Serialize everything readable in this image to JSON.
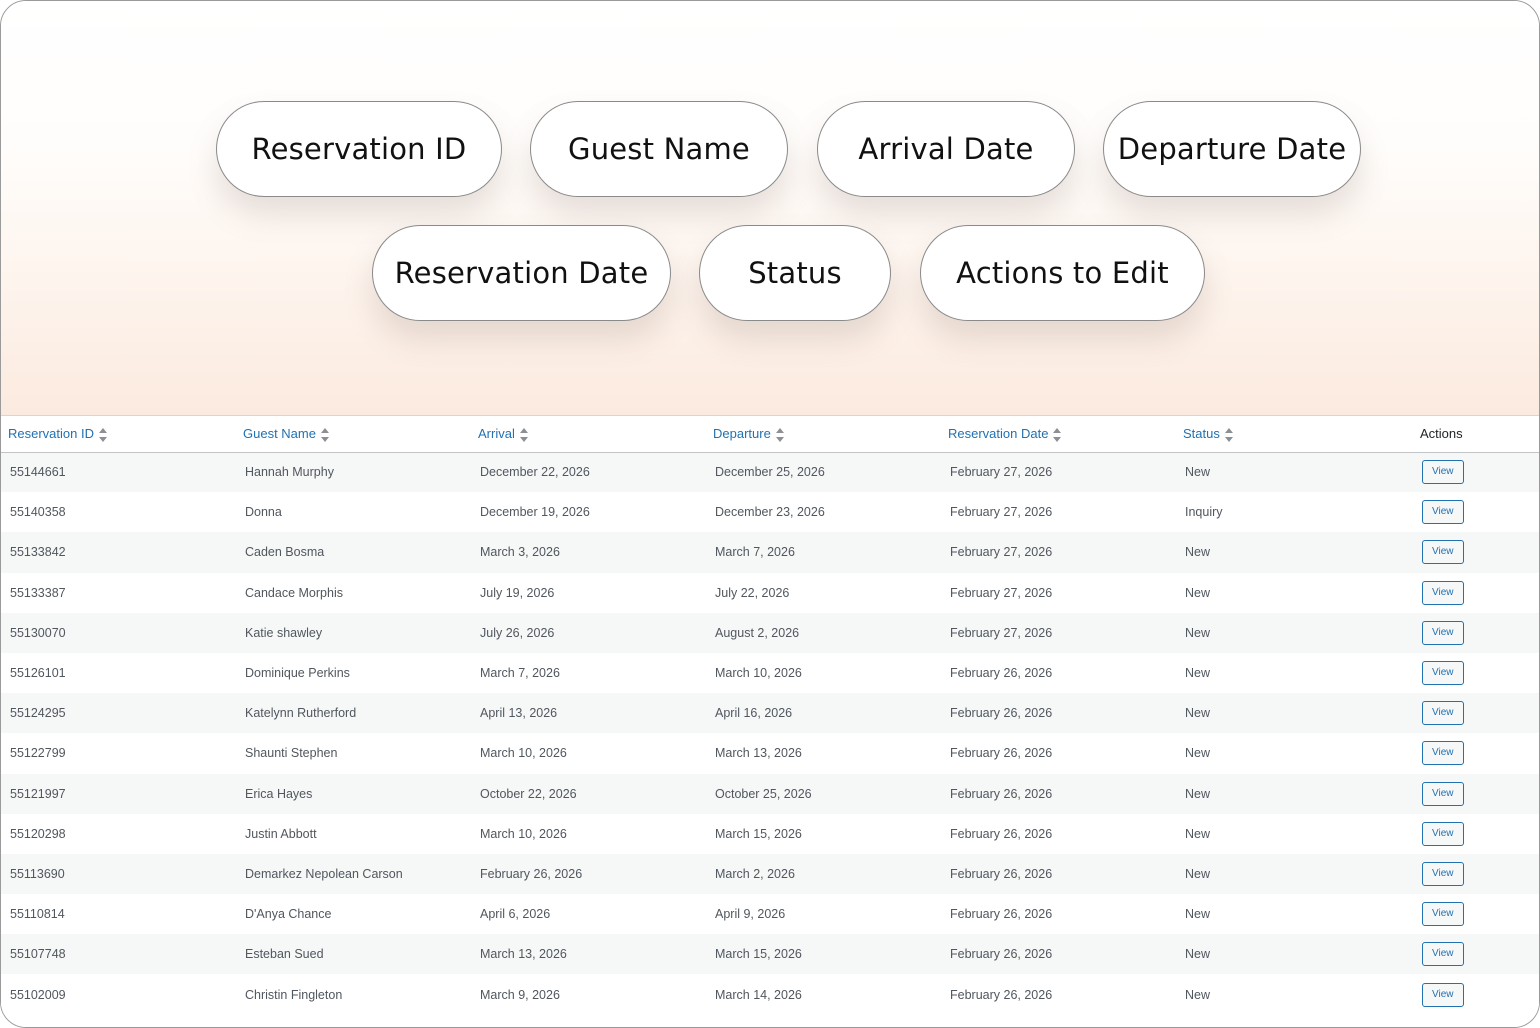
{
  "feature_pills": [
    "Reservation ID",
    "Guest Name",
    "Arrival Date",
    "Departure Date",
    "Reservation Date",
    "Status",
    "Actions to Edit"
  ],
  "table": {
    "columns": [
      {
        "label": "Reservation ID",
        "sortable": true
      },
      {
        "label": "Guest Name",
        "sortable": true
      },
      {
        "label": "Arrival",
        "sortable": true
      },
      {
        "label": "Departure",
        "sortable": true
      },
      {
        "label": "Reservation Date",
        "sortable": true
      },
      {
        "label": "Status",
        "sortable": true
      },
      {
        "label": "Actions",
        "sortable": false
      }
    ],
    "action_label": "View",
    "rows": [
      {
        "id": "55144661",
        "guest": "Hannah Murphy",
        "arrival": "December 22, 2026",
        "departure": "December 25, 2026",
        "reserved": "February 27, 2026",
        "status": "New"
      },
      {
        "id": "55140358",
        "guest": "Donna",
        "arrival": "December 19, 2026",
        "departure": "December 23, 2026",
        "reserved": "February 27, 2026",
        "status": "Inquiry"
      },
      {
        "id": "55133842",
        "guest": "Caden Bosma",
        "arrival": "March 3, 2026",
        "departure": "March 7, 2026",
        "reserved": "February 27, 2026",
        "status": "New"
      },
      {
        "id": "55133387",
        "guest": "Candace Morphis",
        "arrival": "July 19, 2026",
        "departure": "July 22, 2026",
        "reserved": "February 27, 2026",
        "status": "New"
      },
      {
        "id": "55130070",
        "guest": "Katie shawley",
        "arrival": "July 26, 2026",
        "departure": "August 2, 2026",
        "reserved": "February 27, 2026",
        "status": "New"
      },
      {
        "id": "55126101",
        "guest": "Dominique Perkins",
        "arrival": "March 7, 2026",
        "departure": "March 10, 2026",
        "reserved": "February 26, 2026",
        "status": "New"
      },
      {
        "id": "55124295",
        "guest": "Katelynn Rutherford",
        "arrival": "April 13, 2026",
        "departure": "April 16, 2026",
        "reserved": "February 26, 2026",
        "status": "New"
      },
      {
        "id": "55122799",
        "guest": "Shaunti Stephen",
        "arrival": "March 10, 2026",
        "departure": "March 13, 2026",
        "reserved": "February 26, 2026",
        "status": "New"
      },
      {
        "id": "55121997",
        "guest": "Erica Hayes",
        "arrival": "October 22, 2026",
        "departure": "October 25, 2026",
        "reserved": "February 26, 2026",
        "status": "New"
      },
      {
        "id": "55120298",
        "guest": "Justin Abbott",
        "arrival": "March 10, 2026",
        "departure": "March 15, 2026",
        "reserved": "February 26, 2026",
        "status": "New"
      },
      {
        "id": "55113690",
        "guest": "Demarkez Nepolean Carson",
        "arrival": "February 26, 2026",
        "departure": "March 2, 2026",
        "reserved": "February 26, 2026",
        "status": "New"
      },
      {
        "id": "55110814",
        "guest": "D'Anya Chance",
        "arrival": "April 6, 2026",
        "departure": "April 9, 2026",
        "reserved": "February 26, 2026",
        "status": "New"
      },
      {
        "id": "55107748",
        "guest": "Esteban Sued",
        "arrival": "March 13, 2026",
        "departure": "March 15, 2026",
        "reserved": "February 26, 2026",
        "status": "New"
      },
      {
        "id": "55102009",
        "guest": "Christin Fingleton",
        "arrival": "March 9, 2026",
        "departure": "March 14, 2026",
        "reserved": "February 26, 2026",
        "status": "New"
      }
    ]
  }
}
